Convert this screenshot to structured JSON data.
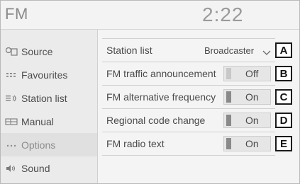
{
  "header": {
    "title": "FM",
    "clock": "2:22"
  },
  "sidebar": {
    "items": [
      {
        "label": "Source",
        "icon": "source-icon",
        "active": false
      },
      {
        "label": "Favourites",
        "icon": "favourites-icon",
        "active": false
      },
      {
        "label": "Station list",
        "icon": "station-list-icon",
        "active": false
      },
      {
        "label": "Manual",
        "icon": "manual-icon",
        "active": false
      },
      {
        "label": "Options",
        "icon": "options-icon",
        "active": true
      },
      {
        "label": "Sound",
        "icon": "sound-icon",
        "active": false
      }
    ]
  },
  "options": {
    "rows": [
      {
        "label": "Station list",
        "value": "Broadcaster",
        "kind": "dropdown",
        "callout": "A"
      },
      {
        "label": "FM traffic announcement",
        "value": "Off",
        "kind": "toggle",
        "state": "off",
        "callout": "B"
      },
      {
        "label": "FM alternative frequency",
        "value": "On",
        "kind": "toggle",
        "state": "on",
        "callout": "C"
      },
      {
        "label": "Regional code change",
        "value": "On",
        "kind": "toggle",
        "state": "on",
        "callout": "D"
      },
      {
        "label": "FM radio text",
        "value": "On",
        "kind": "toggle",
        "state": "on",
        "callout": "E"
      }
    ]
  },
  "colors": {
    "background": "#f2f2f2",
    "sidebar_active": "#e0e0e0",
    "toggle_on_indicator": "#8a8a8a",
    "toggle_off_indicator": "#c8c8c8",
    "callout_border": "#1a1a1a"
  }
}
